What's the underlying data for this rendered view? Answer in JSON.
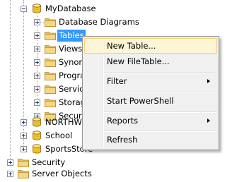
{
  "tree": {
    "database": {
      "label": "MyDatabase",
      "expanded": true
    },
    "children": [
      {
        "label": "Database Diagrams",
        "icon": "folder-icon"
      },
      {
        "label": "Tables",
        "icon": "folder-icon",
        "selected": true
      },
      {
        "label": "Views",
        "icon": "folder-icon"
      },
      {
        "label": "Synor",
        "icon": "folder-icon"
      },
      {
        "label": "Progra",
        "icon": "folder-icon"
      },
      {
        "label": "Servic",
        "icon": "folder-icon"
      },
      {
        "label": "Storag",
        "icon": "folder-icon"
      },
      {
        "label": "Securi",
        "icon": "folder-icon"
      }
    ],
    "databases": [
      {
        "label": "NORTHW",
        "icon": "database-icon"
      },
      {
        "label": "School",
        "icon": "database-icon"
      },
      {
        "label": "SportsStore",
        "icon": "database-icon"
      }
    ],
    "server_nodes": [
      {
        "label": "Security",
        "icon": "folder-icon"
      },
      {
        "label": "Server Objects",
        "icon": "folder-icon"
      }
    ]
  },
  "context_menu": {
    "items": [
      {
        "label": "New Table...",
        "highlighted": true,
        "submenu": false
      },
      {
        "label": "New FileTable...",
        "submenu": false
      },
      {
        "label": "Filter",
        "submenu": true
      },
      {
        "label": "Start PowerShell",
        "submenu": false
      },
      {
        "label": "Reports",
        "submenu": true
      },
      {
        "label": "Refresh",
        "submenu": false
      }
    ]
  },
  "colors": {
    "selection": "#3399ff",
    "folder": "#f6d77f",
    "menu_highlight": "#fdf6d6",
    "database_icon": "#f0c020"
  }
}
